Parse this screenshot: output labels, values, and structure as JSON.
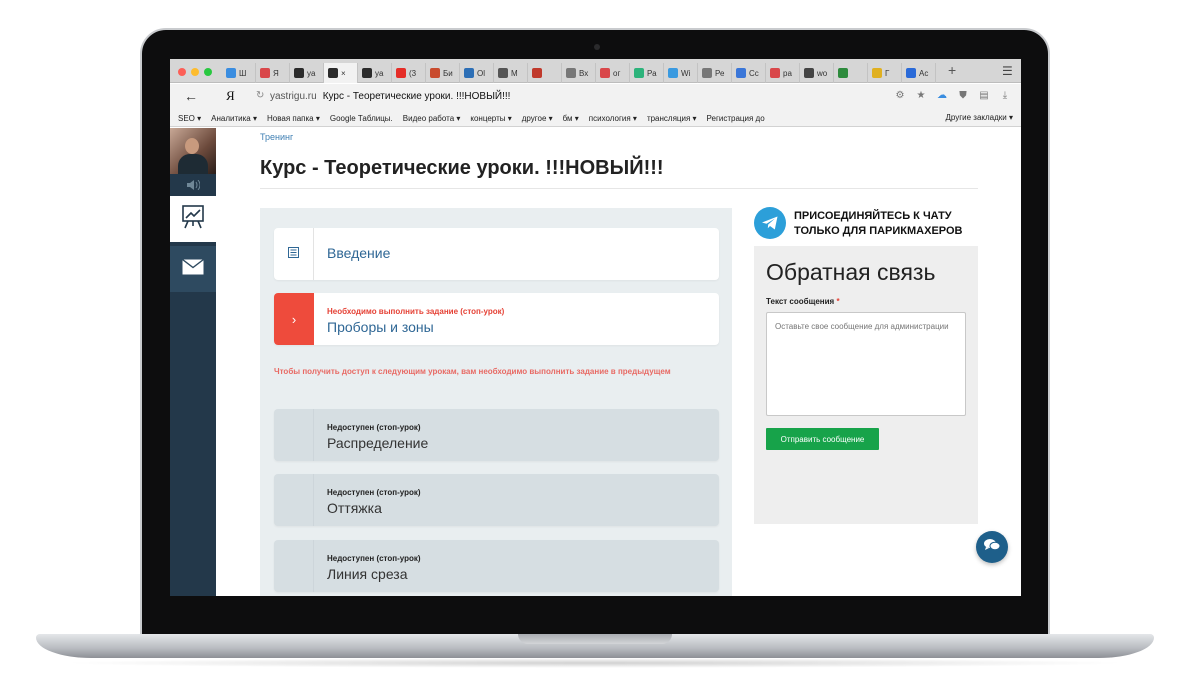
{
  "browser": {
    "tabs": [
      {
        "label": "Ш",
        "icon_color": "#3a8de0"
      },
      {
        "label": "Я",
        "icon_color": "#d9474a"
      },
      {
        "label": "ya",
        "icon_color": "#2b2b2b"
      },
      {
        "label": "×",
        "icon_color": "#2b2b2b",
        "active": true
      },
      {
        "label": "ya",
        "icon_color": "#2b2b2b"
      },
      {
        "label": "(3",
        "icon_color": "#e52d27"
      },
      {
        "label": "Би",
        "icon_color": "#c94c2f"
      },
      {
        "label": "Ol",
        "icon_color": "#2d6fb6"
      },
      {
        "label": "M",
        "icon_color": "#555555"
      },
      {
        "label": "",
        "icon_color": "#c0392b"
      },
      {
        "label": "Вх",
        "icon_color": "#777777"
      },
      {
        "label": "ог",
        "icon_color": "#d9474a"
      },
      {
        "label": "Ра",
        "icon_color": "#2db37b"
      },
      {
        "label": "Wi",
        "icon_color": "#3a9ae0"
      },
      {
        "label": "Ре",
        "icon_color": "#777777"
      },
      {
        "label": "Сс",
        "icon_color": "#3a76d8"
      },
      {
        "label": "ра",
        "icon_color": "#d9474a"
      },
      {
        "label": "wo",
        "icon_color": "#444444"
      },
      {
        "label": "",
        "icon_color": "#2e8b3d"
      },
      {
        "label": "Г",
        "icon_color": "#e0b020"
      },
      {
        "label": "Ac",
        "icon_color": "#2a6ad8"
      }
    ],
    "new_tab": "+",
    "menu": "☰",
    "back": "←",
    "yandex_logo": "Я",
    "url_host": "yastrigu.ru",
    "url_title": "Курс - Теоретические уроки. !!!НОВЫЙ!!!",
    "bookmarks": [
      "SEO ▾",
      "Аналитика ▾",
      "Новая папка ▾",
      "Google Таблицы.",
      "Видео работа ▾",
      "концерты ▾",
      "другое ▾",
      "бм ▾",
      "психология ▾",
      "трансляция ▾",
      "Регистрация до"
    ],
    "other_bookmarks": "Другие закладки ▾"
  },
  "page": {
    "breadcrumb": "Тренинг",
    "title": "Курс - Теоретические уроки. !!!НОВЫЙ!!!",
    "lessons": [
      {
        "status": "",
        "name": "Введение",
        "state": "open"
      },
      {
        "status": "Необходимо выполнить задание (стоп-урок)",
        "name": "Проборы и зоны",
        "state": "current"
      },
      {
        "status": "Недоступен (стоп-урок)",
        "name": "Распределение",
        "state": "locked"
      },
      {
        "status": "Недоступен (стоп-урок)",
        "name": "Оттяжка",
        "state": "locked"
      },
      {
        "status": "Недоступен (стоп-урок)",
        "name": "Линия среза",
        "state": "locked"
      }
    ],
    "lock_note": "Чтобы получить доступ к следующим урокам, вам необходимо выполнить задание  в предыдущем",
    "telegram_banner": {
      "line1": "ПРИСОЕДИНЯЙТЕСЬ К ЧАТУ",
      "line2": "ТОЛЬКО ДЛЯ ПАРИКМАХЕРОВ"
    },
    "feedback": {
      "title": "Обратная связь",
      "label": "Текст сообщения",
      "required_mark": "*",
      "placeholder": "Оставьте свое сообщение для администрации",
      "button": "Отправить сообщение"
    }
  },
  "colors": {
    "sidebar": "#23384a",
    "accent_red": "#ee4b3c",
    "link_blue": "#2f6795",
    "button_green": "#17a34a",
    "telegram_blue": "#2c9fd9"
  }
}
